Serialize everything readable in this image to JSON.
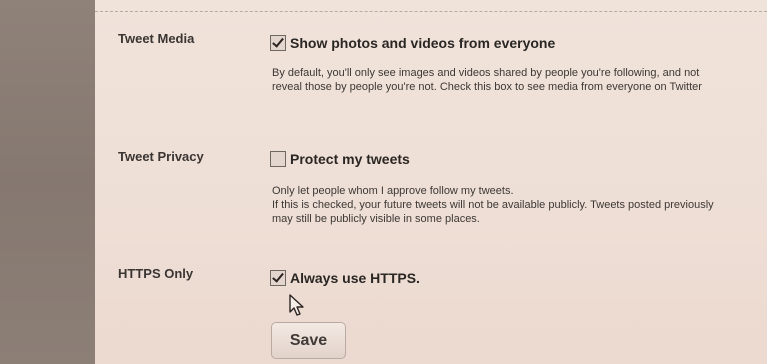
{
  "settings": {
    "tweet_media": {
      "label": "Tweet Media",
      "option_label": "Show photos and videos from everyone",
      "checked": true,
      "description": "By default, you'll only see images and videos shared by people you're following, and not reveal those by people you're not. Check this box to see media from everyone on Twitter"
    },
    "tweet_privacy": {
      "label": "Tweet Privacy",
      "option_label": "Protect my tweets",
      "checked": false,
      "description_line1": "Only let people whom I approve follow my tweets.",
      "description_line2": "If this is checked, your future tweets will not be available publicly. Tweets posted previously may still be publicly visible in some places."
    },
    "https_only": {
      "label": "HTTPS Only",
      "option_label": "Always use HTTPS.",
      "checked": true
    }
  },
  "save_button": {
    "label": "Save"
  },
  "cursor": {
    "icon": "mouse-pointer-icon"
  }
}
